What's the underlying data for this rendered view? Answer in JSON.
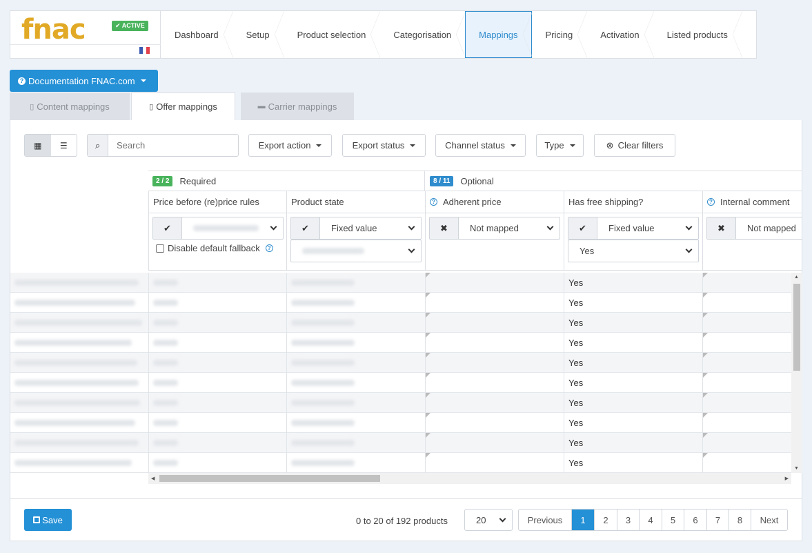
{
  "brand": {
    "logo_text": "fnac",
    "status_badge": "✔ ACTIVE",
    "flag_colors": [
      "#3a5ab0",
      "#ffffff",
      "#e2404a"
    ]
  },
  "steps": [
    {
      "label": "Dashboard",
      "active": false
    },
    {
      "label": "Setup",
      "active": false
    },
    {
      "label": "Product selection",
      "active": false
    },
    {
      "label": "Categorisation",
      "active": false
    },
    {
      "label": "Mappings",
      "active": true
    },
    {
      "label": "Pricing",
      "active": false
    },
    {
      "label": "Activation",
      "active": false
    },
    {
      "label": "Listed products",
      "active": false
    }
  ],
  "documentation_button": "Documentation FNAC.com",
  "tabs": [
    {
      "label": "Content mappings",
      "active": false
    },
    {
      "label": "Offer mappings",
      "active": true
    },
    {
      "label": "Carrier mappings",
      "active": false
    }
  ],
  "toolbar": {
    "search_placeholder": "Search",
    "filters": [
      "Export action",
      "Export status",
      "Channel status",
      "Type"
    ],
    "clear_filters": "Clear filters"
  },
  "groups": {
    "required": {
      "badge": "2 / 2",
      "label": "Required",
      "color": "#49b35c"
    },
    "optional": {
      "badge": "8 / 11",
      "label": "Optional",
      "color": "#2f8ccd"
    }
  },
  "columns": [
    {
      "label": "Price before (re)price rules",
      "help": false
    },
    {
      "label": "Product state",
      "help": false
    },
    {
      "label": "Adherent price",
      "help": true
    },
    {
      "label": "Has free shipping?",
      "help": false
    },
    {
      "label": "Internal comment",
      "help": true
    }
  ],
  "mapping_filters": {
    "col2": {
      "value": "Fixed value",
      "mapped": true
    },
    "col3": {
      "value": "Not mapped",
      "mapped": false
    },
    "col4": {
      "value": "Fixed value",
      "mapped": true,
      "sub_value": "Yes"
    },
    "col5": {
      "value": "Not mapped",
      "mapped": false
    }
  },
  "disable_fallback_label": "Disable default fallback",
  "rows_free_shipping": [
    "Yes",
    "Yes",
    "Yes",
    "Yes",
    "Yes",
    "Yes",
    "Yes",
    "Yes",
    "Yes",
    "Yes"
  ],
  "footer": {
    "save_label": "Save",
    "count_text": "0 to 20 of 192 products",
    "per_page": "20",
    "previous": "Previous",
    "pages": [
      "1",
      "2",
      "3",
      "4",
      "5",
      "6",
      "7",
      "8"
    ],
    "current_page": "1",
    "next": "Next"
  }
}
